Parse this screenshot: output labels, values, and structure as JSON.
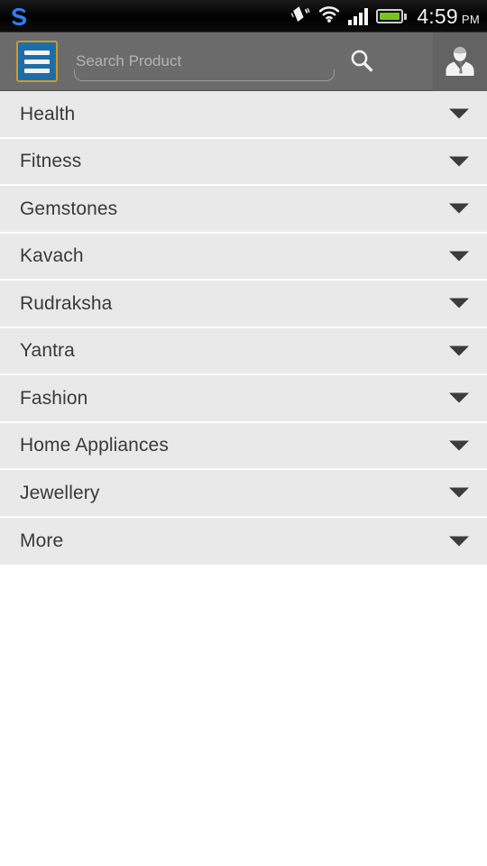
{
  "status_bar": {
    "app_logo_icon": "s-logo-icon",
    "icons": [
      "vibrate-icon",
      "wifi-icon",
      "signal-bars-icon",
      "battery-icon"
    ],
    "signal_bars_filled": 4,
    "battery_level_percent": 100,
    "time": "4:59",
    "period": "PM"
  },
  "header": {
    "menu_icon": "hamburger-menu-icon",
    "search": {
      "value": "",
      "placeholder": "Search Product",
      "icon": "search-icon"
    },
    "profile_icon": "user-avatar-icon",
    "colors": {
      "bar_background": "#6b6b6b",
      "menu_button_fill": "#1d6ea8",
      "menu_button_border": "#cf9a22",
      "profile_button_background": "#636363"
    }
  },
  "category_list": {
    "expand_icon": "chevron-down-icon",
    "items": [
      {
        "label": "Health"
      },
      {
        "label": "Fitness"
      },
      {
        "label": "Gemstones"
      },
      {
        "label": "Kavach"
      },
      {
        "label": "Rudraksha"
      },
      {
        "label": "Yantra"
      },
      {
        "label": "Fashion"
      },
      {
        "label": "Home Appliances"
      },
      {
        "label": "Jewellery"
      },
      {
        "label": "More"
      }
    ],
    "colors": {
      "row_background": "#e9e9e9",
      "row_divider": "#fdfdfd",
      "label_text": "#3a3a3a"
    }
  }
}
